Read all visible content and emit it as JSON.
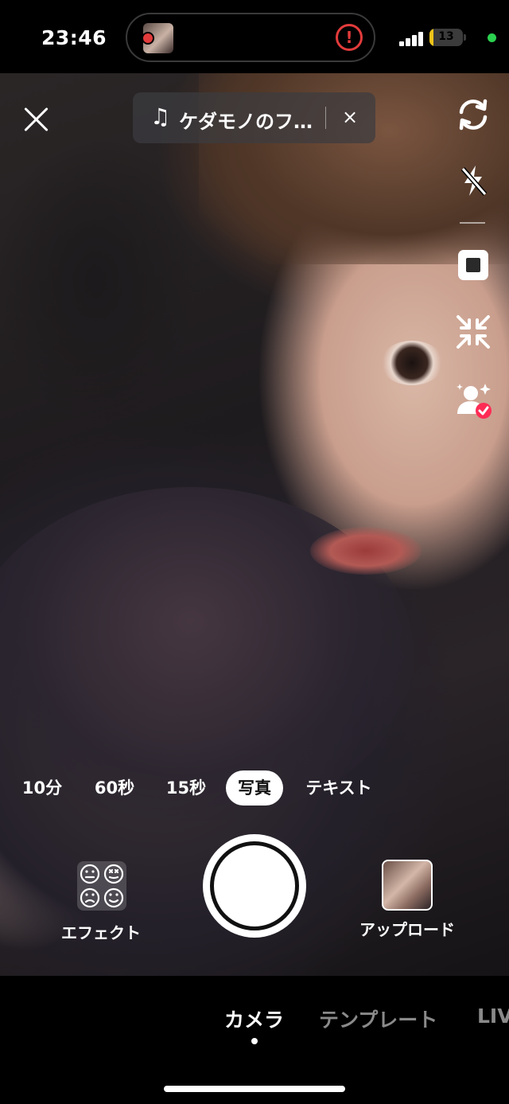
{
  "status_bar": {
    "time": "23:46",
    "battery_percent": 13,
    "battery_label": "13",
    "recording_indicator_color": "#e23b3b",
    "alert_color": "#e23b3b",
    "privacy_dot_color": "#2bd14f",
    "alert_glyph": "!"
  },
  "top_bar": {
    "close_icon": "close-icon",
    "music": {
      "note_glyph": "♫",
      "title": "ケダモノのフ…",
      "remove_glyph": "×"
    }
  },
  "side_tools": [
    {
      "name": "flip-camera",
      "icon": "flip-camera-icon"
    },
    {
      "name": "flash-off",
      "icon": "flash-off-icon"
    },
    {
      "name": "aspect-ratio",
      "icon": "aspect-ratio-icon"
    },
    {
      "name": "collapse",
      "icon": "collapse-arrows-icon"
    },
    {
      "name": "beauty",
      "icon": "beauty-person-icon"
    }
  ],
  "modes": {
    "items": [
      "10分",
      "60秒",
      "15秒",
      "写真",
      "テキスト"
    ],
    "active": "写真"
  },
  "capture": {
    "effects_label": "エフェクト",
    "upload_label": "アップロード"
  },
  "bottom_tabs": {
    "items": [
      "カメラ",
      "テンプレート",
      "LIV"
    ],
    "active": "カメラ"
  }
}
